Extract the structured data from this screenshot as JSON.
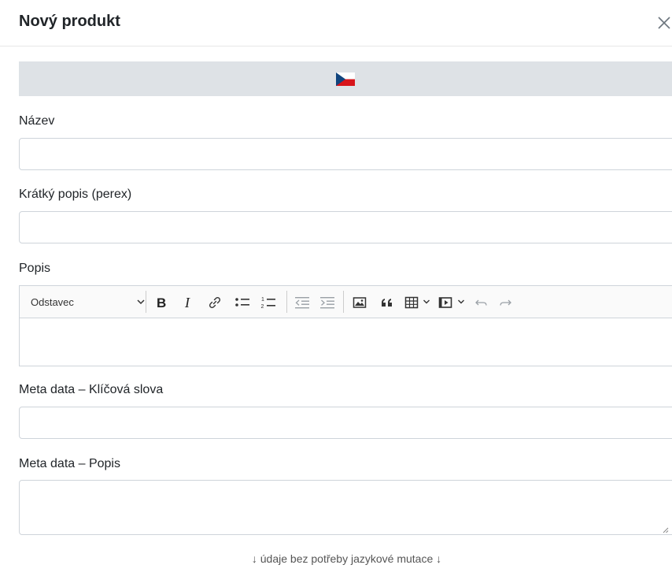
{
  "modal": {
    "title": "Nový produkt",
    "close_icon": "close-icon"
  },
  "language_bar": {
    "active_flag": "czech-flag-icon"
  },
  "fields": {
    "name": {
      "label": "Název",
      "value": "",
      "placeholder": ""
    },
    "perex": {
      "label": "Krátký popis (perex)",
      "value": "",
      "placeholder": ""
    },
    "description": {
      "label": "Popis",
      "toolbar": {
        "heading_value": "Odstavec",
        "buttons": [
          "bold-icon",
          "italic-icon",
          "link-icon",
          "bulleted-list-icon",
          "numbered-list-icon",
          "outdent-icon",
          "indent-icon",
          "image-icon",
          "block-quote-icon",
          "table-icon",
          "media-embed-icon",
          "undo-icon",
          "redo-icon"
        ]
      }
    },
    "meta_keywords": {
      "label": "Meta data – Klíčová slova",
      "value": "",
      "placeholder": ""
    },
    "meta_description": {
      "label": "Meta data – Popis",
      "value": "",
      "placeholder": ""
    }
  },
  "footer_note": "↓ údaje bez potřeby jazykové mutace ↓",
  "colors": {
    "lang_bar_bg": "#dee2e6",
    "border": "#ced4da",
    "text": "#212529"
  }
}
